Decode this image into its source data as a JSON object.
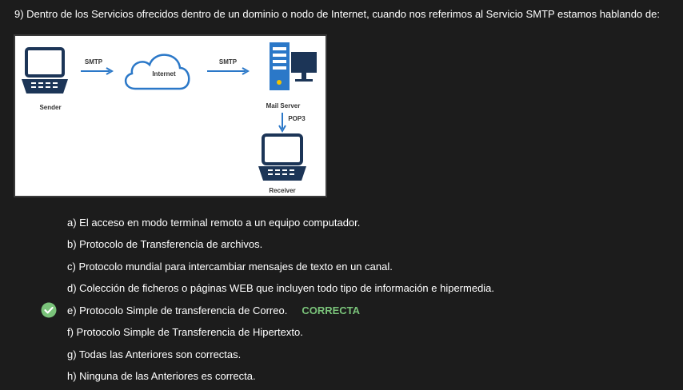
{
  "question": {
    "text": "9) Dentro de los Servicios ofrecidos dentro de un dominio o nodo de Internet, cuando nos referimos al Servicio SMTP estamos hablando de:"
  },
  "diagram": {
    "labels": {
      "sender": "Sender",
      "smtp1": "SMTP",
      "internet": "Internet",
      "smtp2": "SMTP",
      "mail_server": "Mail Server",
      "pop3": "POP3",
      "receiver": "Receiver"
    },
    "icons": [
      "laptop-icon",
      "cloud-icon",
      "server-icon",
      "laptop-icon"
    ],
    "colors": {
      "accent": "#2b78c8",
      "navy": "#1c3557"
    }
  },
  "options": [
    {
      "text": "a) El acceso en modo terminal remoto a un equipo computador."
    },
    {
      "text": "b) Protocolo de Transferencia de archivos."
    },
    {
      "text": "c) Protocolo mundial para intercambiar mensajes de texto en un canal."
    },
    {
      "text": "d) Colección de ficheros o páginas WEB que incluyen todo tipo de información e hipermedia."
    },
    {
      "text": "e) Protocolo Simple de transferencia de Correo.",
      "correct": true,
      "tag": "CORRECTA"
    },
    {
      "text": "f) Protocolo Simple de Transferencia de Hipertexto."
    },
    {
      "text": "g) Todas las Anteriores son correctas."
    },
    {
      "text": "h) Ninguna de las Anteriores es correcta."
    }
  ],
  "colors": {
    "correct_green": "#7ac37a"
  }
}
